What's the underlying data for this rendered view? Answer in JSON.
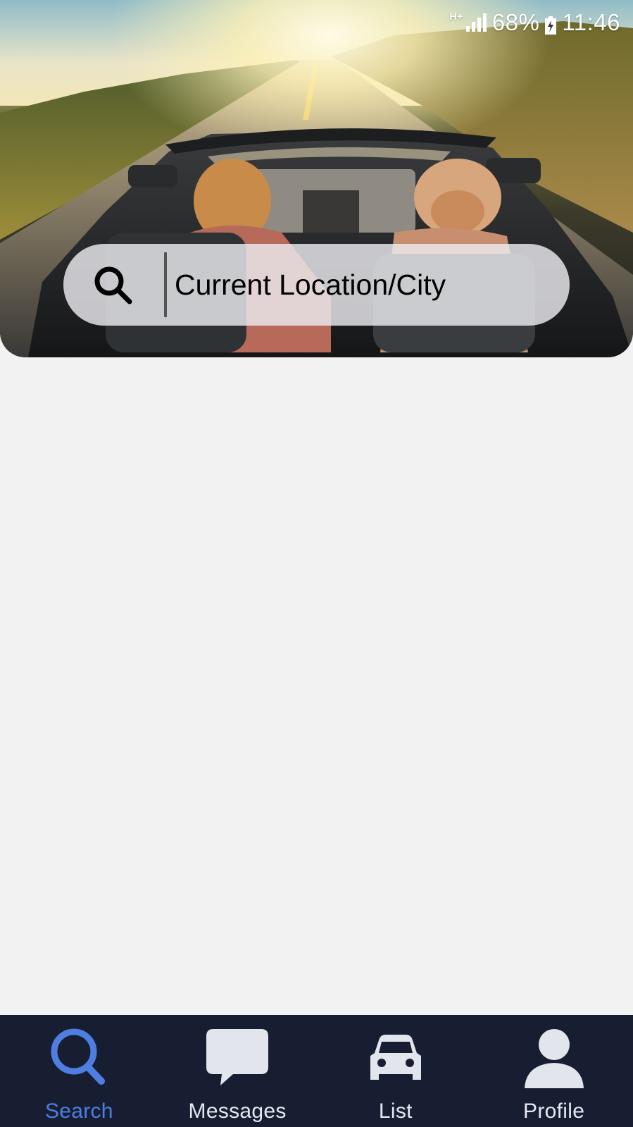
{
  "status_bar": {
    "network": "H+",
    "battery_percent": "68%",
    "time": "11:46"
  },
  "search": {
    "placeholder": "Current Location/City",
    "icon": "search-icon"
  },
  "hero": {
    "image": "convertible-road-trip-photo"
  },
  "bottom_nav": {
    "items": [
      {
        "label": "Search",
        "icon": "search-icon",
        "active": true
      },
      {
        "label": "Messages",
        "icon": "chat-bubble-icon",
        "active": false
      },
      {
        "label": "List",
        "icon": "car-icon",
        "active": false
      },
      {
        "label": "Profile",
        "icon": "person-icon",
        "active": false
      }
    ]
  },
  "colors": {
    "nav_background": "#171e32",
    "active_accent": "#4f7ee0",
    "inactive_icon": "#e3e5ec",
    "page_background": "#f2f2f2"
  }
}
